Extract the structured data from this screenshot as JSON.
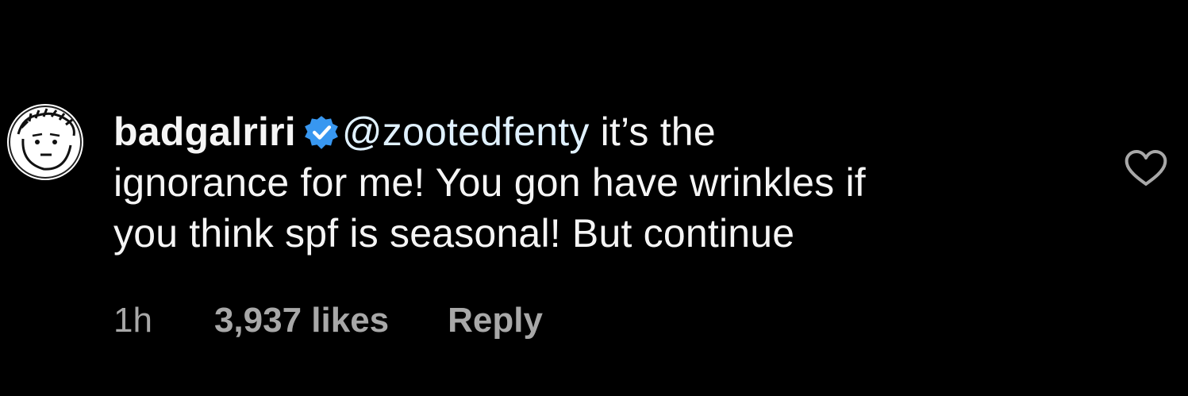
{
  "comment": {
    "username": "badgalriri",
    "verified": true,
    "mention": "@zootedfenty",
    "text_line1": " it’s the",
    "text_line2": "ignorance for me! You gon have wrinkles if",
    "text_line3": "you think spf is seasonal! But continue",
    "time": "1h",
    "likes": "3,937 likes",
    "reply_label": "Reply"
  },
  "icons": {
    "verified": "verified-badge-icon",
    "like": "heart-outline-icon",
    "avatar": "user-avatar"
  },
  "colors": {
    "background": "#000000",
    "text": "#f5f5f5",
    "mention": "#e0f1ff",
    "meta": "#a8a8a8",
    "verified_badge": "#3897f0"
  }
}
